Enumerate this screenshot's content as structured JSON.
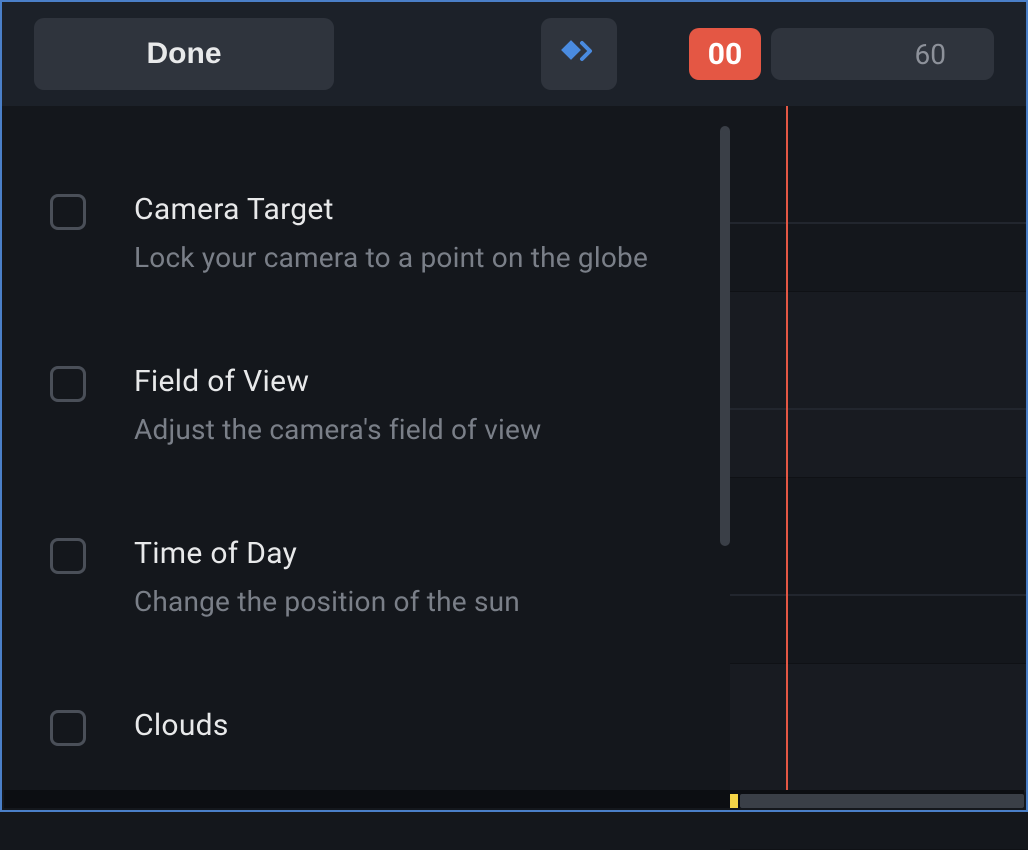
{
  "toolbar": {
    "done_label": "Done",
    "time_current": "00",
    "time_tick": "60"
  },
  "options": [
    {
      "title": "Camera Target",
      "desc": "Lock your camera to a point on the globe",
      "checked": false
    },
    {
      "title": "Field of View",
      "desc": "Adjust the camera's field of view",
      "checked": false
    },
    {
      "title": "Time of Day",
      "desc": "Change the position of the sun",
      "checked": false
    },
    {
      "title": "Clouds",
      "desc": "",
      "checked": false
    }
  ],
  "colors": {
    "accent_red": "#e45744",
    "accent_blue": "#4a7fc8",
    "accent_yellow": "#f5d547"
  }
}
